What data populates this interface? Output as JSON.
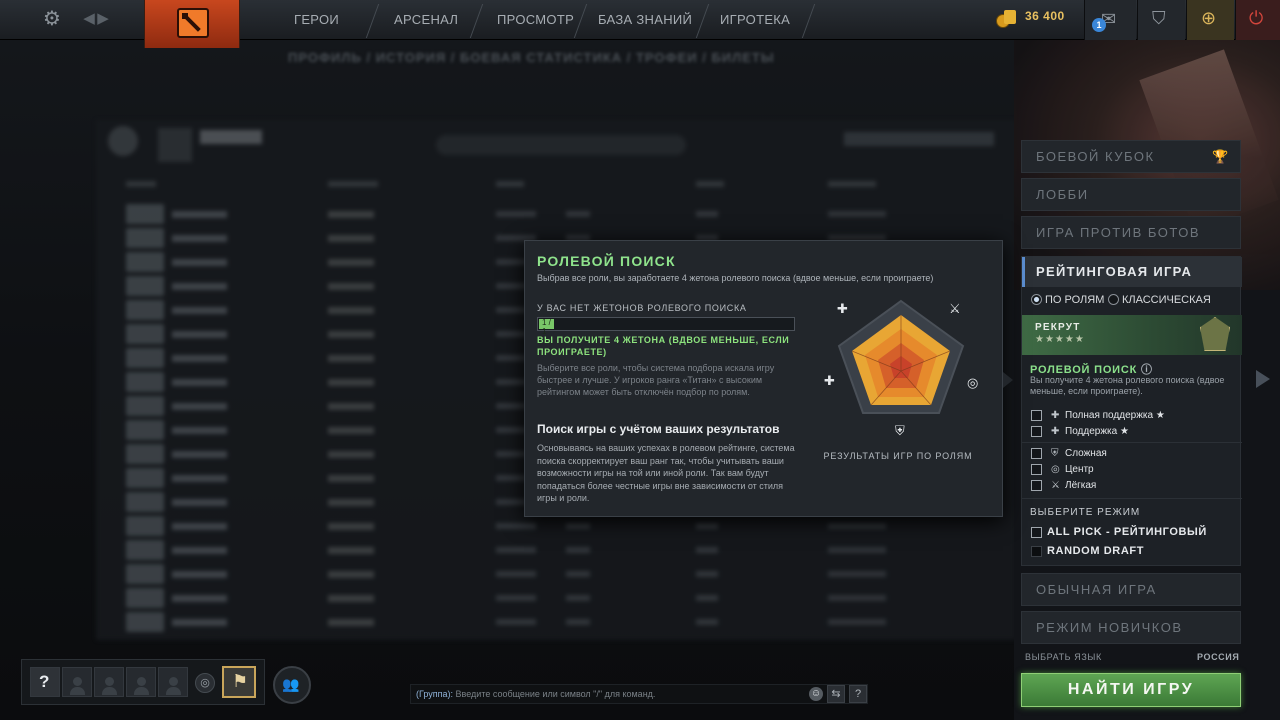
{
  "topbar": {
    "nav": [
      "ГЕРОИ",
      "АРСЕНАЛ",
      "ПРОСМОТР",
      "БАЗА ЗНАНИЙ",
      "ИГРОТЕКА"
    ],
    "shards": "36 400",
    "inbox_count": "1"
  },
  "profile_tabs": "ПРОФИЛЬ / ИСТОРИЯ / БОЕВАЯ СТАТИСТИКА / ТРОФЕИ / БИЛЕТЫ",
  "popup": {
    "title": "РОЛЕВОЙ ПОИСК",
    "subtitle": "Выбрав все роли, вы заработаете 4 жетона ролевого поиска (вдвое меньше, если проиграете)",
    "tokens_label": "У ВАС НЕТ ЖЕТОНОВ РОЛЕВОГО ПОИСКА",
    "progress": 0.06,
    "progress_label": "1 / 1",
    "win_text": "ВЫ ПОЛУЧИТЕ 4 ЖЕТОНА (ВДВОЕ МЕНЬШЕ, ЕСЛИ ПРОИГРАЕТЕ)",
    "para1": "Выберите все роли, чтобы система подбора искала игру быстрее и лучше. У игроков ранга «Титан» с высоким рейтингом может быть отключён подбор по ролям.",
    "heading2": "Поиск игры с учётом ваших результатов",
    "para2": "Основываясь на ваших успехах в ролевом рейтинге, система поиска скорректирует ваш ранг так, чтобы учитывать ваши возможности игры на той или иной роли. Так вам будут попадаться более честные игры вне зависимости от стиля игры и роли.",
    "chart_label": "РЕЗУЛЬТАТЫ ИГР ПО РОЛЯМ"
  },
  "right_panel": {
    "modes_top": [
      "БОЕВОЙ КУБОК",
      "ЛОББИ",
      "ИГРА ПРОТИВ БОТОВ"
    ],
    "ranked": {
      "title": "РЕЙТИНГОВАЯ ИГРА",
      "radio_roles": "ПО РОЛЯМ",
      "radio_classic": "КЛАССИЧЕСКАЯ",
      "rank_name": "РЕКРУТ",
      "rank_stars": "★★★★★",
      "role_search_title": "РОЛЕВОЙ ПОИСК",
      "role_search_desc": "Вы получите 4 жетона ролевого поиска (вдвое меньше, если проиграете).",
      "roles_a": [
        {
          "label": "Полная поддержка ★",
          "icon": "full-support-icon"
        },
        {
          "label": "Поддержка ★",
          "icon": "support-icon"
        }
      ],
      "roles_b": [
        {
          "label": "Сложная",
          "icon": "offlane-icon"
        },
        {
          "label": "Центр",
          "icon": "mid-icon"
        },
        {
          "label": "Лёгкая",
          "icon": "safelane-icon"
        }
      ],
      "mode_title": "ВЫБЕРИТЕ РЕЖИМ",
      "modes": [
        "ALL PICK - РЕЙТИНГОВЫЙ",
        "RANDOM DRAFT"
      ]
    },
    "modes_bottom": [
      "ОБЫЧНАЯ ИГРА",
      "РЕЖИМ НОВИЧКОВ"
    ],
    "language_label": "ВЫБРАТЬ ЯЗЫК",
    "region": "РОССИЯ",
    "play_button": "НАЙТИ ИГРУ"
  },
  "chat": {
    "group": "(Группа):",
    "placeholder": "Введите сообщение или символ \"/\" для команд."
  },
  "colors": {
    "accent_green": "#8fe38c",
    "play_green": "#4e9444",
    "brand_orange": "#c8471e"
  }
}
